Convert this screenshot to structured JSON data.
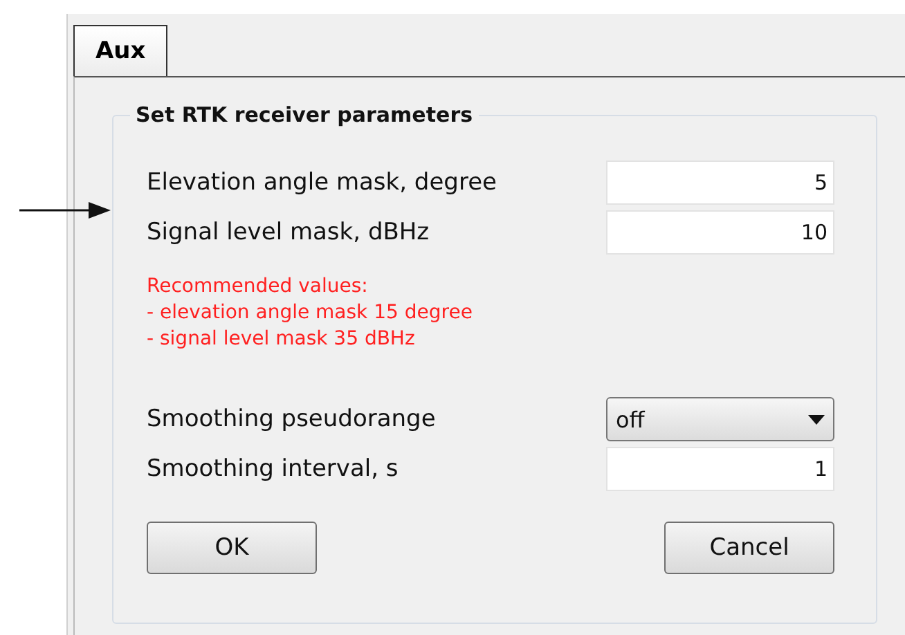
{
  "tabs": [
    {
      "label": "Aux",
      "selected": true
    }
  ],
  "group": {
    "title": "Set RTK receiver parameters",
    "fields": [
      {
        "kind": "text",
        "label": "Elevation angle mask, degree",
        "value": "5"
      },
      {
        "kind": "text",
        "label": "Signal level mask, dBHz",
        "value": "10"
      }
    ],
    "note": [
      "Recommended values:",
      "- elevation angle mask 15 degree",
      "- signal level mask 35 dBHz"
    ],
    "fields_2": [
      {
        "kind": "dropdown",
        "label": "Smoothing pseudorange",
        "value": "off"
      },
      {
        "kind": "text",
        "label": "Smoothing interval, s",
        "value": "1"
      }
    ],
    "buttons": [
      "OK",
      "Cancel"
    ]
  }
}
